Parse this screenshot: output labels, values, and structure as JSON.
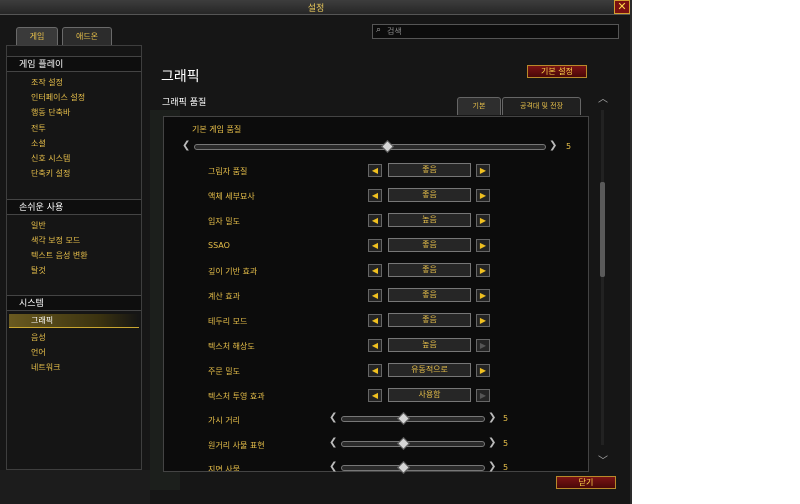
{
  "window": {
    "title": "설정"
  },
  "top_tabs": [
    {
      "label": "게임"
    },
    {
      "label": "애드온"
    }
  ],
  "search": {
    "placeholder": "검색"
  },
  "sidebar": {
    "sections": [
      {
        "header": "게임 플레이",
        "items": [
          "조작 설정",
          "인터페이스 설정",
          "행동 단축바",
          "전투",
          "소셜",
          "신호 시스템",
          "단축키 설정"
        ]
      },
      {
        "header": "손쉬운 사용",
        "items": [
          "일반",
          "색각 보정 모드",
          "텍스트 음성 변환",
          "탈것"
        ]
      },
      {
        "header": "시스템",
        "items": [
          "그래픽",
          "음성",
          "언어",
          "네트워크"
        ]
      }
    ],
    "selected": "그래픽"
  },
  "panel": {
    "title": "그래픽",
    "defaults_button": "기본 설정",
    "quality_label": "그래픽 품질",
    "sub_tabs": [
      {
        "label": "기본"
      },
      {
        "label": "공격대 및 전장"
      }
    ],
    "base_quality": {
      "label": "기본 게임 품질",
      "value": "5",
      "fraction": 0.55
    },
    "settings": [
      {
        "label": "그림자 품질",
        "value": "좋음",
        "right_enabled": true
      },
      {
        "label": "액체 세부묘사",
        "value": "좋음",
        "right_enabled": true
      },
      {
        "label": "입자 밀도",
        "value": "높음",
        "right_enabled": true
      },
      {
        "label": "SSAO",
        "value": "좋음",
        "right_enabled": true
      },
      {
        "label": "깊이 기반 효과",
        "value": "좋음",
        "right_enabled": true
      },
      {
        "label": "계산 효과",
        "value": "좋음",
        "right_enabled": true
      },
      {
        "label": "테두리 모드",
        "value": "좋음",
        "right_enabled": true
      },
      {
        "label": "텍스처 해상도",
        "value": "높음",
        "right_enabled": false
      },
      {
        "label": "주문 밀도",
        "value": "유동적으로",
        "right_enabled": true
      },
      {
        "label": "텍스처 투영 효과",
        "value": "사용함",
        "right_enabled": false
      }
    ],
    "sliders": [
      {
        "label": "가시 거리",
        "value": "5",
        "fraction": 0.44
      },
      {
        "label": "원거리 사물 표현",
        "value": "5",
        "fraction": 0.44
      },
      {
        "label": "지면 사물",
        "value": "5",
        "fraction": 0.44
      }
    ]
  },
  "footer": {
    "close_label": "닫기"
  },
  "colors": {
    "accent": "#e8c04a",
    "button_red": "#7a1414",
    "background": "#161616"
  }
}
